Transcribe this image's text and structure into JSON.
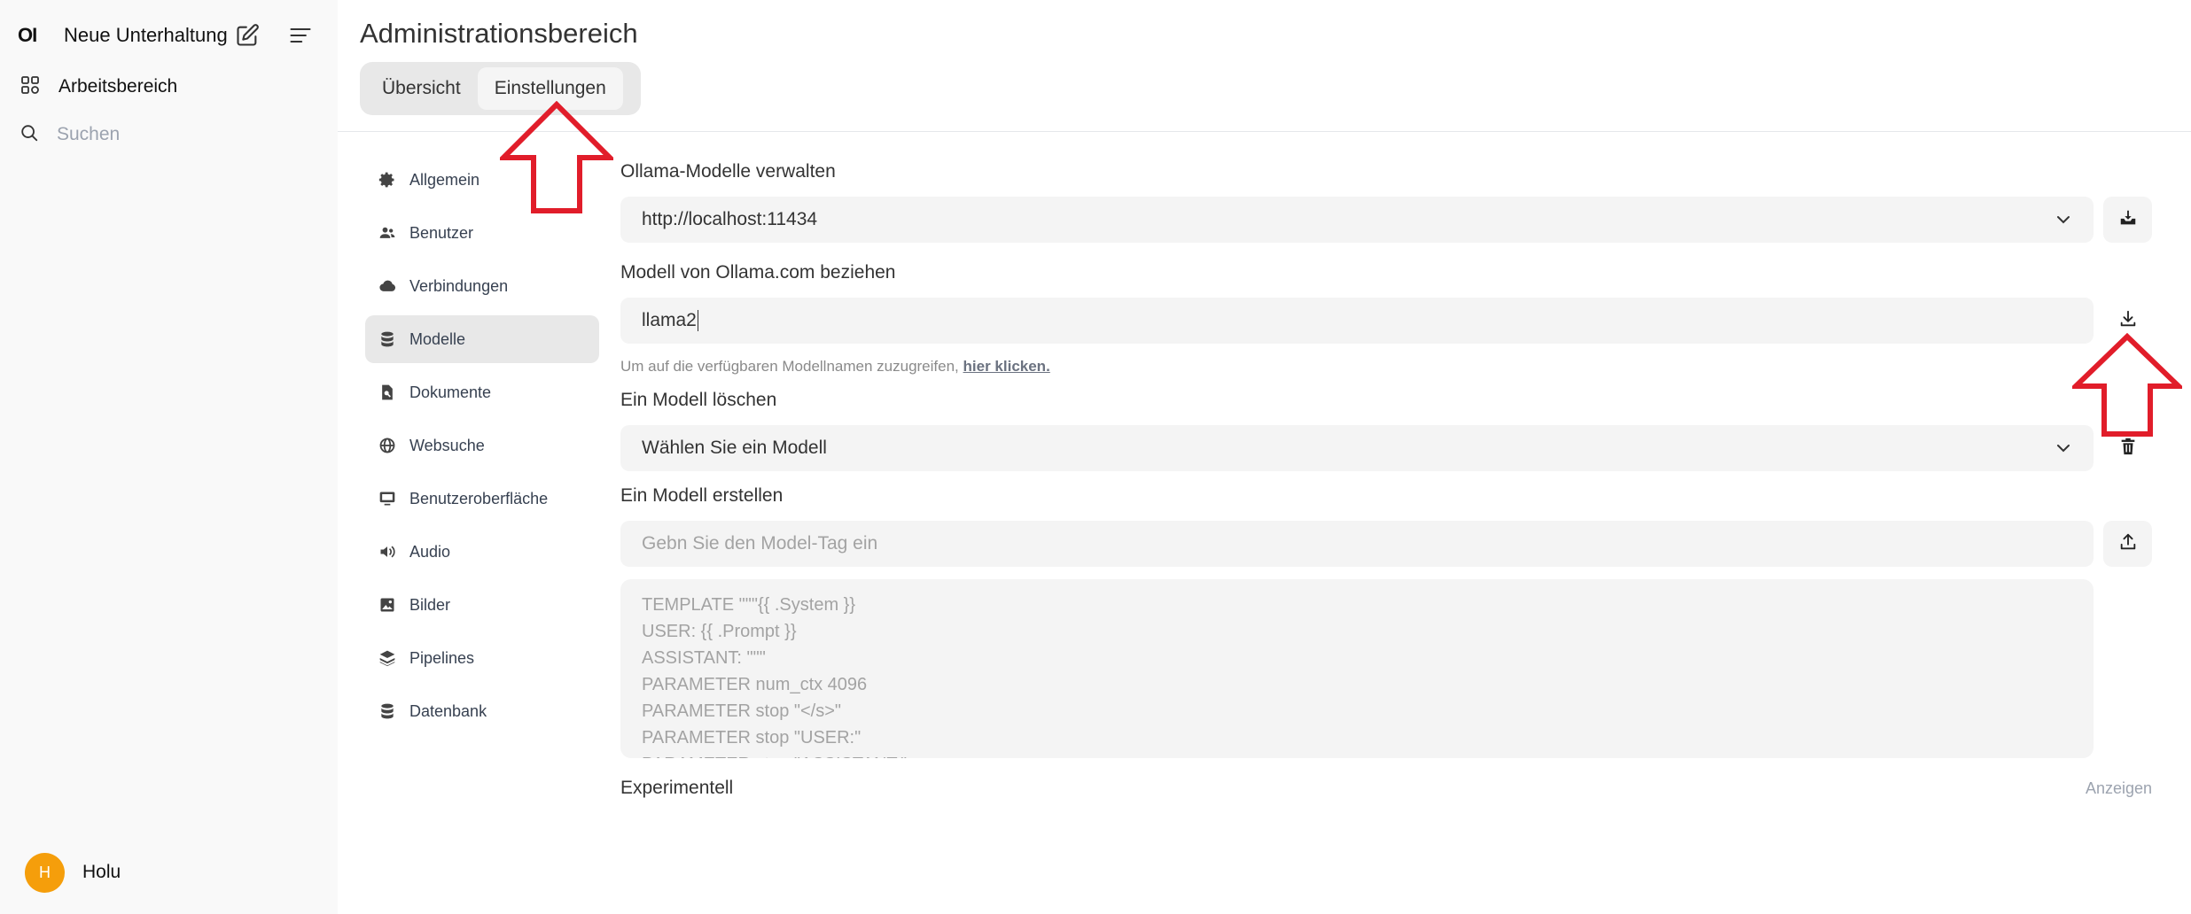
{
  "sidebar": {
    "logo": "OI",
    "new_chat": "Neue Unterhaltung",
    "workspace": "Arbeitsbereich",
    "search_placeholder": "Suchen",
    "user": {
      "initial": "H",
      "name": "Holu"
    }
  },
  "header": {
    "title": "Administrationsbereich",
    "tabs": [
      {
        "label": "Übersicht"
      },
      {
        "label": "Einstellungen"
      }
    ]
  },
  "settings_nav": [
    {
      "label": "Allgemein",
      "icon": "gear-icon"
    },
    {
      "label": "Benutzer",
      "icon": "users-icon"
    },
    {
      "label": "Verbindungen",
      "icon": "cloud-icon"
    },
    {
      "label": "Modelle",
      "icon": "database-icon"
    },
    {
      "label": "Dokumente",
      "icon": "document-search-icon"
    },
    {
      "label": "Websuche",
      "icon": "globe-icon"
    },
    {
      "label": "Benutzeroberfläche",
      "icon": "monitor-icon"
    },
    {
      "label": "Audio",
      "icon": "speaker-icon"
    },
    {
      "label": "Bilder",
      "icon": "image-icon"
    },
    {
      "label": "Pipelines",
      "icon": "layers-icon"
    },
    {
      "label": "Datenbank",
      "icon": "database-icon"
    }
  ],
  "models": {
    "manage_label": "Ollama-Modelle verwalten",
    "ollama_url": "http://localhost:11434",
    "pull_label": "Modell von Ollama.com beziehen",
    "pull_value": "llama2",
    "hint_text": "Um auf die verfügbaren Modellnamen zuzugreifen,",
    "hint_link": "hier klicken.",
    "delete_label": "Ein Modell löschen",
    "delete_select": "Wählen Sie ein Modell",
    "create_label": "Ein Modell erstellen",
    "create_placeholder": "Gebn Sie den Model-Tag ein",
    "modelfile_placeholder": "TEMPLATE \"\"\"{{ .System }}\nUSER: {{ .Prompt }}\nASSISTANT: \"\"\"\nPARAMETER num_ctx 4096\nPARAMETER stop \"</s>\"\nPARAMETER stop \"USER:\"\nPARAMETER stop \"ASSISTANT:\"",
    "experimental_label": "Experimentell",
    "show_label": "Anzeigen"
  },
  "colors": {
    "annotation_arrow": "#e11d2a",
    "avatar": "#f59e0b"
  }
}
